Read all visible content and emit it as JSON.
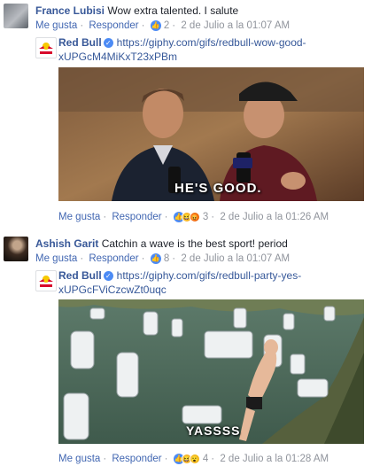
{
  "comments": [
    {
      "author": "France Lubisi",
      "text": "Wow extra talented. I salute",
      "actions": {
        "like": "Me gusta",
        "reply": "Responder",
        "count": "2",
        "date": "2 de Julio a la 01:07 AM"
      },
      "reply": {
        "author": "Red Bull",
        "link_line1": "https://giphy.com/gifs/redbull-wow-good-",
        "link_line2": "xUPGcM4MiKxT23xPBm",
        "gif_caption": "HE'S GOOD.",
        "actions": {
          "like": "Me gusta",
          "reply": "Responder",
          "count": "3",
          "date": "2 de Julio a la 01:26 AM"
        }
      }
    },
    {
      "author": "Ashish Garit",
      "text": "Catchin a wave is the best sport! period",
      "actions": {
        "like": "Me gusta",
        "reply": "Responder",
        "count": "8",
        "date": "2 de Julio a la 01:07 AM"
      },
      "reply": {
        "author": "Red Bull",
        "link_line1": "https://giphy.com/gifs/redbull-party-yes-",
        "link_line2": "xUPGcFViCzcwZt0uqc",
        "gif_caption": "YASSSS",
        "actions": {
          "like": "Me gusta",
          "reply": "Responder",
          "count": "4",
          "date": "2 de Julio a la 01:28 AM"
        }
      }
    }
  ],
  "colors": {
    "link": "#365899",
    "author": "#385898",
    "meta": "#90949c",
    "like": "#4c8bf5"
  },
  "icons": {
    "verified": "verified-badge-icon",
    "like": "like-reaction-icon",
    "haha": "haha-reaction-icon",
    "wow": "wow-reaction-icon",
    "angry": "angry-reaction-icon"
  }
}
